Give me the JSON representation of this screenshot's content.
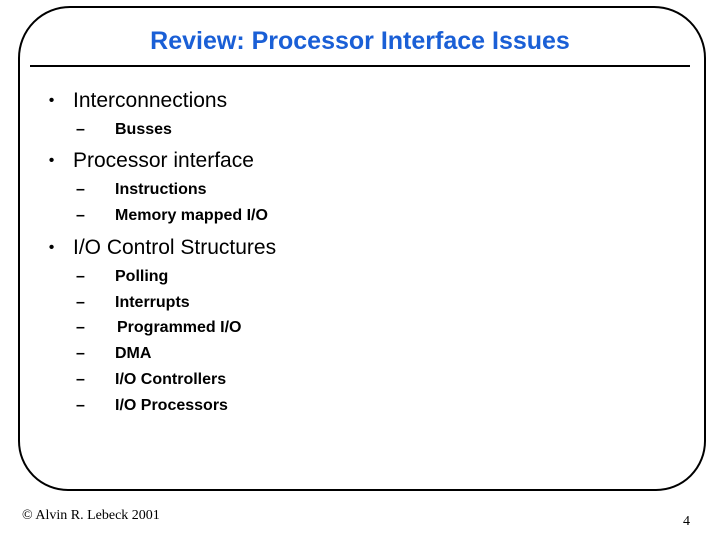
{
  "slide": {
    "title": "Review: Processor Interface Issues",
    "title_color": "#1a5fd6",
    "bullets": [
      {
        "label": "Interconnections",
        "subitems": [
          "Busses"
        ]
      },
      {
        "label": "Processor interface",
        "subitems": [
          "Instructions",
          "Memory mapped I/O"
        ]
      },
      {
        "label": "I/O Control Structures",
        "subitems": [
          "Polling",
          "Interrupts",
          "Programmed I/O",
          "DMA",
          "I/O Controllers",
          "I/O Processors"
        ]
      }
    ],
    "bullet_glyph": "•",
    "dash_glyph": "–",
    "footer": {
      "copyright": "© Alvin R. Lebeck 2001",
      "page_number": "4"
    }
  }
}
